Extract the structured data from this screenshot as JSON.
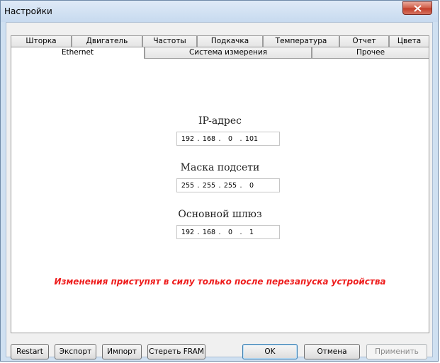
{
  "window": {
    "title": "Настройки"
  },
  "tabs_row1": [
    "Шторка",
    "Двигатель",
    "Частоты",
    "Подкачка",
    "Температура",
    "Отчет",
    "Цвета"
  ],
  "tabs_row2": [
    "Ethernet",
    "Система измерения",
    "Прочее"
  ],
  "active_tab": "Ethernet",
  "fields": [
    {
      "label": "IP-адрес",
      "octets": [
        "192",
        "168",
        "0",
        "101"
      ]
    },
    {
      "label": "Маска подсети",
      "octets": [
        "255",
        "255",
        "255",
        "0"
      ]
    },
    {
      "label": "Основной шлюз",
      "octets": [
        "192",
        "168",
        "0",
        "1"
      ]
    }
  ],
  "warning": "Изменения приступят в силу только после перезапуска устройства",
  "buttons": {
    "restart": "Restart",
    "export": "Экспорт",
    "import": "Импорт",
    "erase": "Стереть FRAM",
    "ok": "OK",
    "cancel": "Отмена",
    "apply": "Применить"
  },
  "colors": {
    "warning": "#ee1c1c",
    "title_bar": "#c7daef",
    "close": "#c13c28"
  }
}
